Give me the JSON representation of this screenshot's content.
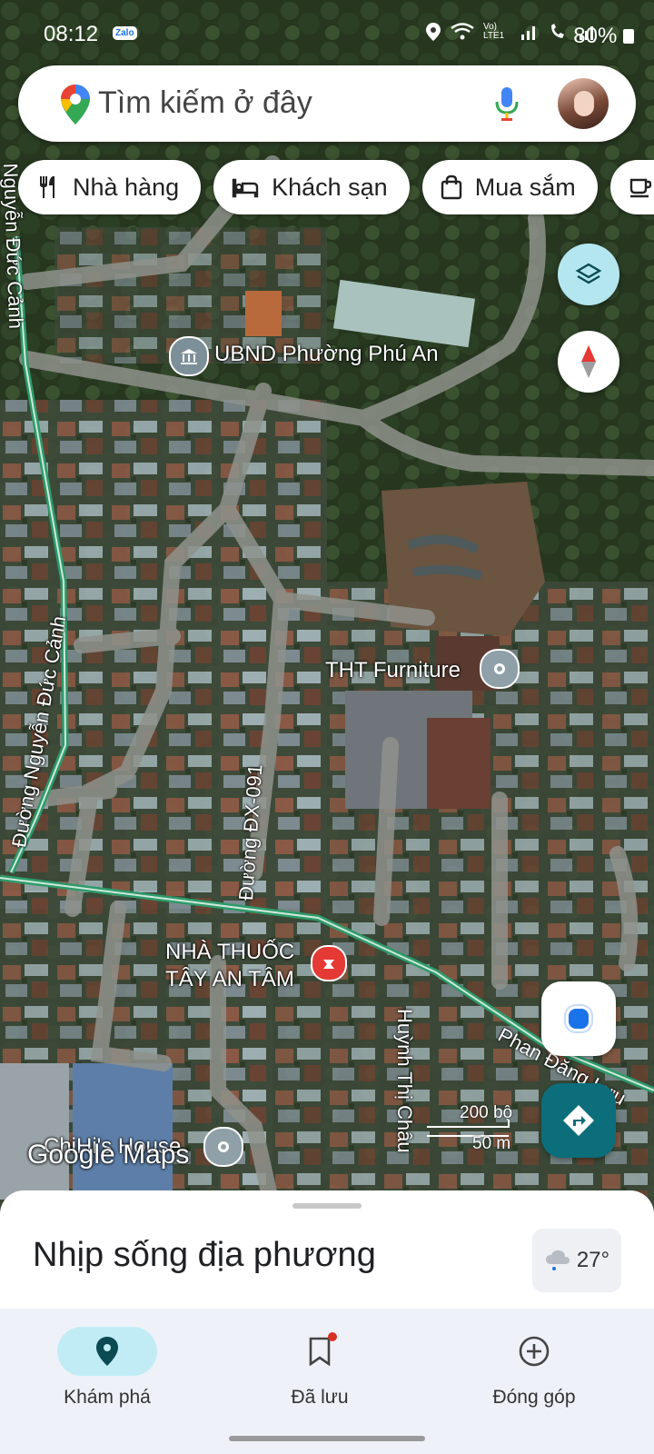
{
  "status_bar": {
    "time": "08:12",
    "zalo_badge": "Zalo",
    "network": "Vo) LTE1",
    "battery": "80%"
  },
  "search": {
    "placeholder": "Tìm kiếm ở đây"
  },
  "chips": [
    {
      "label": "Nhà hàng",
      "icon": "fork-knife-icon"
    },
    {
      "label": "Khách sạn",
      "icon": "bed-icon"
    },
    {
      "label": "Mua sắm",
      "icon": "shopping-bag-icon"
    }
  ],
  "map": {
    "places": {
      "ubnd": "UBND Phường Phú An",
      "furniture": "THT Furniture",
      "pharmacy_line1": "NHÀ THUỐC",
      "pharmacy_line2": "TÂY AN TÂM",
      "chihis": "ChiHi's House"
    },
    "roads": {
      "nguyen_duc_canh_top": "Nguyễn Đức Cảnh",
      "nguyen_duc_canh_full": "Đường Nguyễn Đức Cảnh",
      "dx091": "Đường ĐX-091",
      "huynh_thi_chau": "Huỳnh Thị Châu",
      "phan_dang_luu": "Phan Đăng Lưu"
    },
    "watermark": "Google Maps",
    "scale": {
      "imperial": "200 bộ",
      "metric": "50 m"
    }
  },
  "colors": {
    "accent": "#0b6e7a",
    "location_blue": "#1a73e8",
    "road_green": "#2e9a6a",
    "pharmacy_red": "#e53935"
  },
  "sheet": {
    "title": "Nhịp sống địa phương",
    "temperature": "27°"
  },
  "nav": [
    {
      "label": "Khám phá",
      "icon": "location-pin-icon",
      "active": true
    },
    {
      "label": "Đã lưu",
      "icon": "bookmark-icon",
      "badge": true
    },
    {
      "label": "Đóng góp",
      "icon": "add-circle-icon"
    }
  ]
}
